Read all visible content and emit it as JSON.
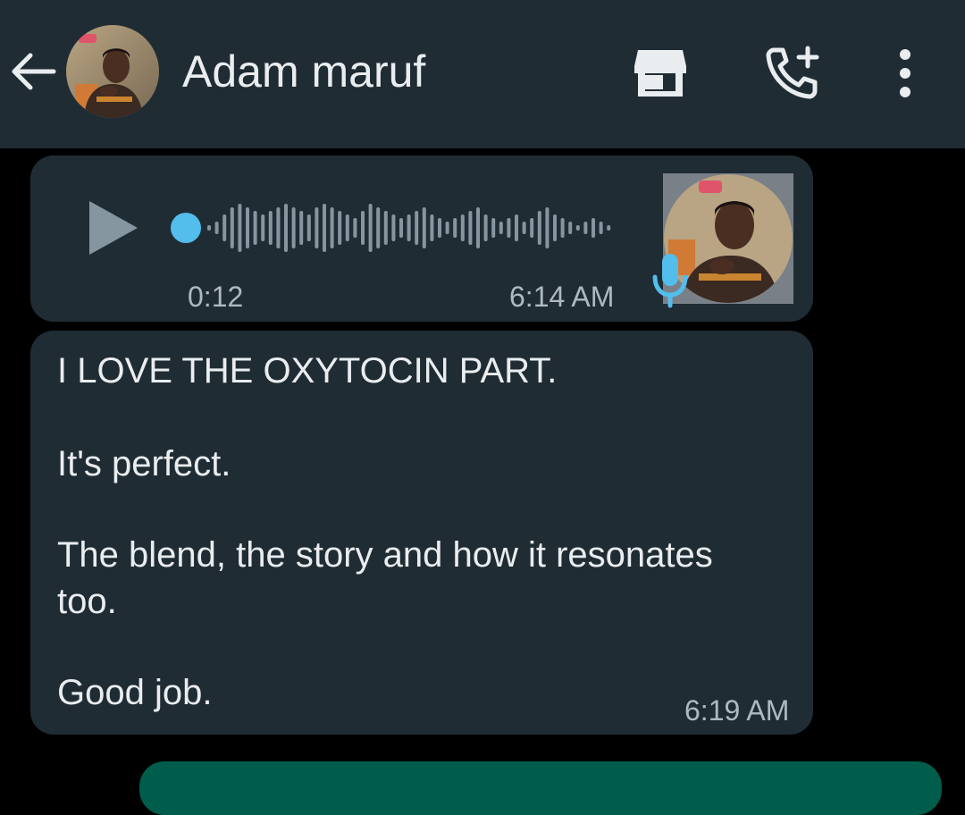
{
  "header": {
    "contact_name": "Adam maruf",
    "icons": [
      "back-arrow-icon",
      "avatar",
      "store-icon",
      "add-call-icon",
      "more-vert-icon"
    ]
  },
  "voice_message": {
    "duration": "0:12",
    "time": "6:14 AM",
    "progress": 0,
    "icons": [
      "play-icon",
      "mic-icon"
    ]
  },
  "text_message": {
    "lines": [
      "I LOVE THE OXYTOCIN PART.",
      "It's perfect.",
      "The blend, the story and how it resonates",
      "too.",
      "Good job."
    ],
    "time": "6:19 AM"
  },
  "colors": {
    "header_bg": "#202c33",
    "bubble_bg": "#202c33",
    "outgoing_bg": "#005c4b",
    "accent": "#53bdeb",
    "chat_bg": "#000000"
  }
}
